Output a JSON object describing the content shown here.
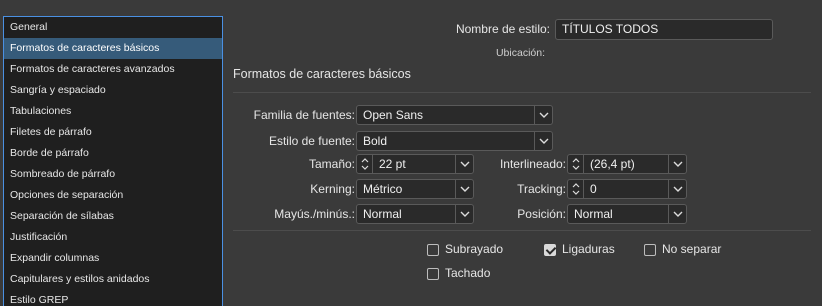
{
  "sidebar": {
    "items": [
      {
        "label": "General",
        "selected": false
      },
      {
        "label": "Formatos de caracteres básicos",
        "selected": true
      },
      {
        "label": "Formatos de caracteres avanzados",
        "selected": false
      },
      {
        "label": "Sangría y espaciado",
        "selected": false
      },
      {
        "label": "Tabulaciones",
        "selected": false
      },
      {
        "label": "Filetes de párrafo",
        "selected": false
      },
      {
        "label": "Borde de párrafo",
        "selected": false
      },
      {
        "label": "Sombreado de párrafo",
        "selected": false
      },
      {
        "label": "Opciones de separación",
        "selected": false
      },
      {
        "label": "Separación de sílabas",
        "selected": false
      },
      {
        "label": "Justificación",
        "selected": false
      },
      {
        "label": "Expandir columnas",
        "selected": false
      },
      {
        "label": "Capitulares y estilos anidados",
        "selected": false
      },
      {
        "label": "Estilo GREP",
        "selected": false
      }
    ]
  },
  "header": {
    "style_name_label": "Nombre de estilo:",
    "style_name_value": "TÍTULOS TODOS",
    "location_label": "Ubicación:"
  },
  "section": {
    "title": "Formatos de caracteres básicos"
  },
  "form": {
    "font_family_label": "Familia de fuentes:",
    "font_family_value": "Open Sans",
    "font_style_label": "Estilo de fuente:",
    "font_style_value": "Bold",
    "size_label": "Tamaño:",
    "size_value": "22 pt",
    "leading_label": "Interlineado:",
    "leading_value": "(26,4 pt)",
    "kerning_label": "Kerning:",
    "kerning_value": "Métrico",
    "tracking_label": "Tracking:",
    "tracking_value": "0",
    "case_label": "Mayús./minús.:",
    "case_value": "Normal",
    "position_label": "Posición:",
    "position_value": "Normal"
  },
  "options": {
    "underline_label": "Subrayado",
    "underline_checked": false,
    "ligatures_label": "Ligaduras",
    "ligatures_checked": true,
    "nobreak_label": "No separar",
    "nobreak_checked": false,
    "strikethrough_label": "Tachado",
    "strikethrough_checked": false
  },
  "icons": {
    "dropdown": "chevron-down-icon",
    "stepper": "stepper-icon"
  }
}
